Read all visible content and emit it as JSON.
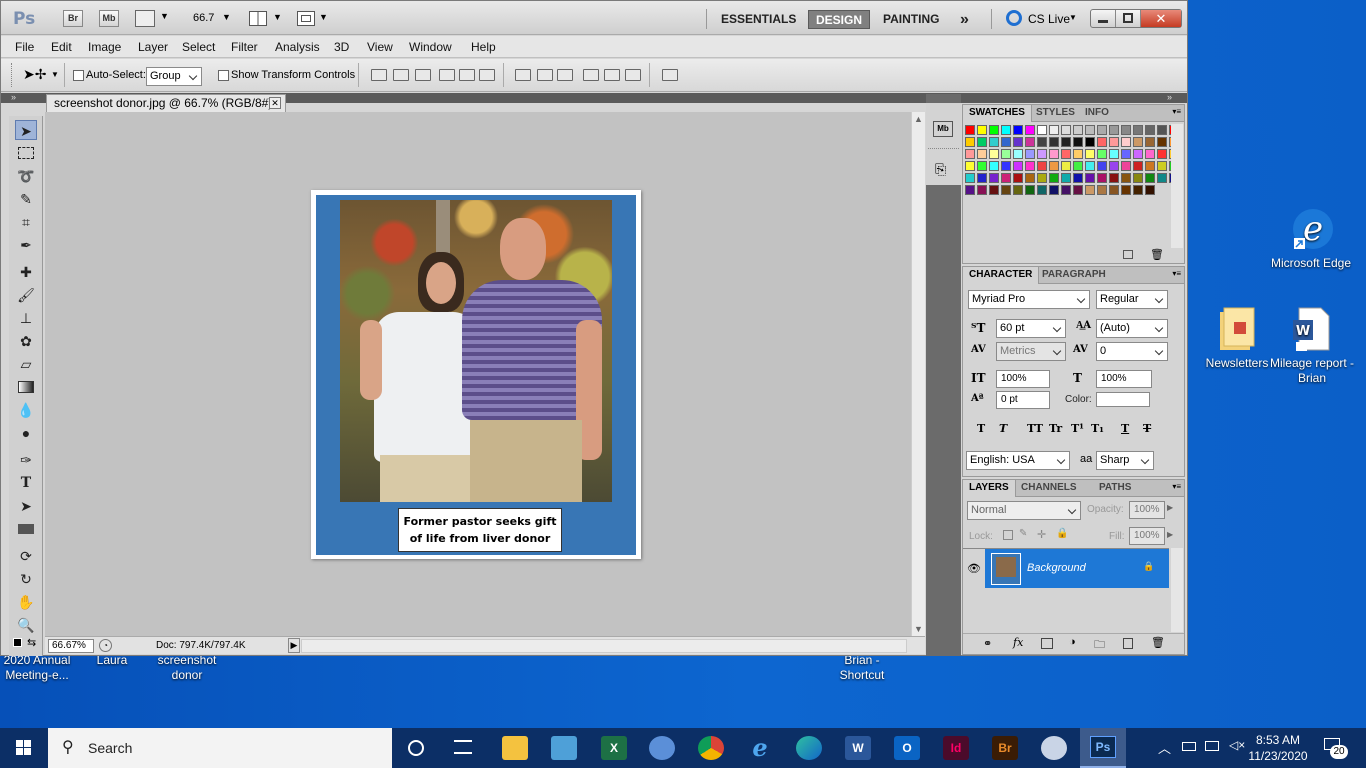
{
  "desktop": {
    "edge_label": "Microsoft Edge",
    "newsletters_label": "Newsletters",
    "mileage_label": "Mileage report - Brian",
    "behind": [
      "2020 Annual",
      "Meeting-e...",
      "Laura",
      "screenshot",
      "donor",
      "Brian -",
      "Shortcut"
    ]
  },
  "ps": {
    "logo": "Ps",
    "br": "Br",
    "mb": "Mb",
    "zoom": "66.7",
    "workspaces": [
      "ESSENTIALS",
      "DESIGN",
      "PAINTING"
    ],
    "more": "»",
    "cslive": "CS Live",
    "menu": [
      "File",
      "Edit",
      "Image",
      "Layer",
      "Select",
      "Filter",
      "Analysis",
      "3D",
      "View",
      "Window",
      "Help"
    ],
    "options": {
      "autoselect": "Auto-Select:",
      "group": "Group",
      "transform": "Show Transform Controls"
    },
    "doc_tab": "screenshot donor.jpg @ 66.7% (RGB/8#)",
    "caption_line1": "Former pastor seeks gift",
    "caption_line2": "of life from liver donor",
    "status_zoom": "66.67%",
    "status_doc": "Doc: 797.4K/797.4K"
  },
  "swatches": {
    "tabs": [
      "SWATCHES",
      "STYLES",
      "INFO"
    ]
  },
  "character": {
    "tabs": [
      "CHARACTER",
      "PARAGRAPH"
    ],
    "font": "Myriad Pro",
    "style": "Regular",
    "size": "60 pt",
    "leading": "(Auto)",
    "kerning": "Metrics",
    "tracking": "0",
    "vscale": "100%",
    "hscale": "100%",
    "baseline": "0 pt",
    "color_label": "Color:",
    "language": "English: USA",
    "aa": "Sharp",
    "aa_icon": "aa"
  },
  "layers": {
    "tabs": [
      "LAYERS",
      "CHANNELS",
      "PATHS"
    ],
    "blend": "Normal",
    "opacity_label": "Opacity:",
    "opacity": "100%",
    "lock_label": "Lock:",
    "fill_label": "Fill:",
    "fill": "100%",
    "layer_name": "Background"
  },
  "taskbar": {
    "search": "Search",
    "time": "8:53 AM",
    "date": "11/23/2020",
    "notif": "20"
  }
}
